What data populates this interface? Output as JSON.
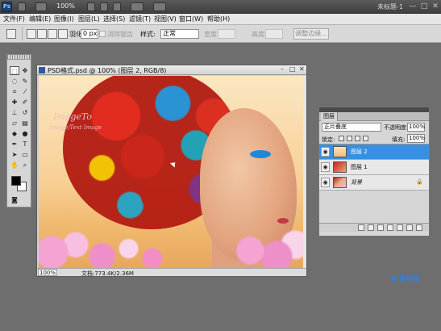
{
  "appbar": {
    "logo": "Ps",
    "zoom": "100%",
    "workspace": "未标题-1",
    "buttons": [
      "—",
      "□",
      "✕"
    ]
  },
  "menu": [
    "文件(F)",
    "编辑(E)",
    "图像(I)",
    "图层(L)",
    "选择(S)",
    "滤镜(T)",
    "视图(V)",
    "窗口(W)",
    "帮助(H)"
  ],
  "options": {
    "feather_label": "羽化:",
    "feather_value": "0 px",
    "antialias_label": "消除锯齿",
    "style_label": "样式:",
    "style_value": "正常",
    "width_label": "宽度:",
    "height_label": "高度:",
    "refine_button": "调整边缘..."
  },
  "document": {
    "title": "PSD格式.psd @ 100% (图层 2, RGB/8)",
    "zoom": "100%",
    "doc_info": "文档:773.4K/2.36M",
    "watermark_title": "ImageTo",
    "watermark_sub": "Image/Text Image"
  },
  "layers": {
    "tab": "图层",
    "blend_mode": "正片叠底",
    "opacity_label": "不透明度:",
    "opacity": "100%",
    "lock_label": "锁定:",
    "fill_label": "填充:",
    "fill": "100%",
    "items": [
      {
        "name": "图层 2",
        "active": true
      },
      {
        "name": "图层 1",
        "active": false
      },
      {
        "name": "背景",
        "active": false,
        "locked": true
      }
    ]
  },
  "brand": "东哥网校",
  "colors": {
    "accent": "#3a8fe0",
    "foreground": "#000000",
    "background": "#ffffff"
  }
}
